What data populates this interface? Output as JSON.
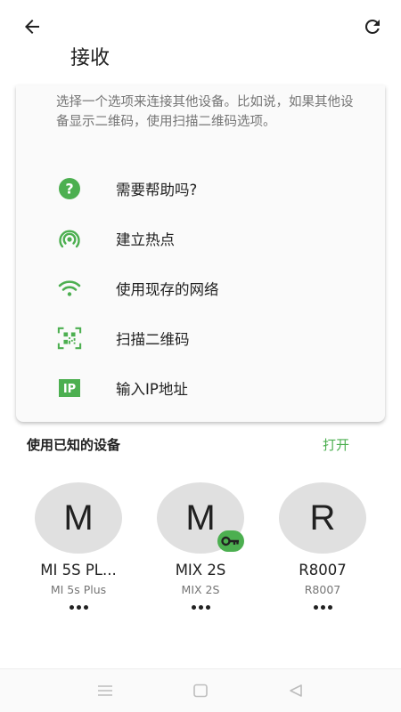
{
  "header": {
    "title": "接收",
    "back_icon": "arrow-left-icon",
    "refresh_icon": "refresh-icon"
  },
  "card": {
    "description": "选择一个选项来连接其他设备。比如说，如果其他设备显示二维码，使用扫描二维码选项。",
    "options": [
      {
        "label": "需要帮助吗?",
        "icon": "help-icon"
      },
      {
        "label": "建立热点",
        "icon": "hotspot-icon"
      },
      {
        "label": "使用现存的网络",
        "icon": "wifi-icon"
      },
      {
        "label": "扫描二维码",
        "icon": "qr-scan-icon"
      },
      {
        "label": "输入IP地址",
        "icon": "ip-icon"
      }
    ],
    "ip_badge_text": "IP"
  },
  "known_devices": {
    "title": "使用已知的设备",
    "action": "打开",
    "devices": [
      {
        "initial": "M",
        "name": "MI 5S PL...",
        "model": "MI 5s Plus"
      },
      {
        "initial": "M",
        "name": "MIX 2S",
        "model": "MIX 2S",
        "badge": "key-icon"
      },
      {
        "initial": "R",
        "name": "R8007",
        "model": "R8007"
      }
    ]
  },
  "colors": {
    "accent": "#4caf50",
    "card_bg": "#fafafa",
    "avatar_bg": "#e0e0e0"
  }
}
